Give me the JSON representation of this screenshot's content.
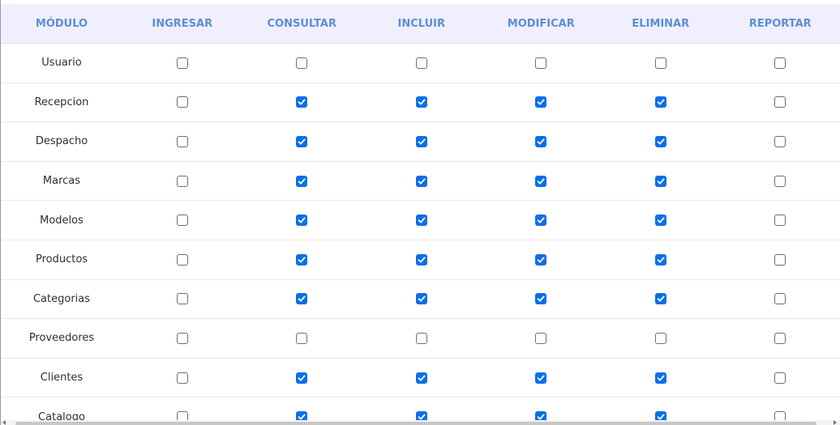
{
  "table": {
    "headers": [
      "MÓDULO",
      "INGRESAR",
      "CONSULTAR",
      "INCLUIR",
      "MODIFICAR",
      "ELIMINAR",
      "REPORTAR"
    ],
    "permission_keys": [
      "ingresar",
      "consultar",
      "incluir",
      "modificar",
      "eliminar",
      "reportar"
    ],
    "rows": [
      {
        "module": "Usuario",
        "ingresar": false,
        "consultar": false,
        "incluir": false,
        "modificar": false,
        "eliminar": false,
        "reportar": false
      },
      {
        "module": "Recepcion",
        "ingresar": false,
        "consultar": true,
        "incluir": true,
        "modificar": true,
        "eliminar": true,
        "reportar": false
      },
      {
        "module": "Despacho",
        "ingresar": false,
        "consultar": true,
        "incluir": true,
        "modificar": true,
        "eliminar": true,
        "reportar": false
      },
      {
        "module": "Marcas",
        "ingresar": false,
        "consultar": true,
        "incluir": true,
        "modificar": true,
        "eliminar": true,
        "reportar": false
      },
      {
        "module": "Modelos",
        "ingresar": false,
        "consultar": true,
        "incluir": true,
        "modificar": true,
        "eliminar": true,
        "reportar": false
      },
      {
        "module": "Productos",
        "ingresar": false,
        "consultar": true,
        "incluir": true,
        "modificar": true,
        "eliminar": true,
        "reportar": false
      },
      {
        "module": "Categorias",
        "ingresar": false,
        "consultar": true,
        "incluir": true,
        "modificar": true,
        "eliminar": true,
        "reportar": false
      },
      {
        "module": "Proveedores",
        "ingresar": false,
        "consultar": false,
        "incluir": false,
        "modificar": false,
        "eliminar": false,
        "reportar": false
      },
      {
        "module": "Clientes",
        "ingresar": false,
        "consultar": true,
        "incluir": true,
        "modificar": true,
        "eliminar": true,
        "reportar": false
      },
      {
        "module": "Catalogo",
        "ingresar": false,
        "consultar": true,
        "incluir": true,
        "modificar": true,
        "eliminar": true,
        "reportar": false
      }
    ]
  },
  "colors": {
    "header_bg": "#f1effd",
    "header_text": "#5b8fd6",
    "checkbox_checked": "#0b6fe8",
    "checkbox_border": "#6f6f6f"
  },
  "icons": {
    "checked": "checkbox-checked-icon",
    "unchecked": "checkbox-unchecked-icon"
  }
}
